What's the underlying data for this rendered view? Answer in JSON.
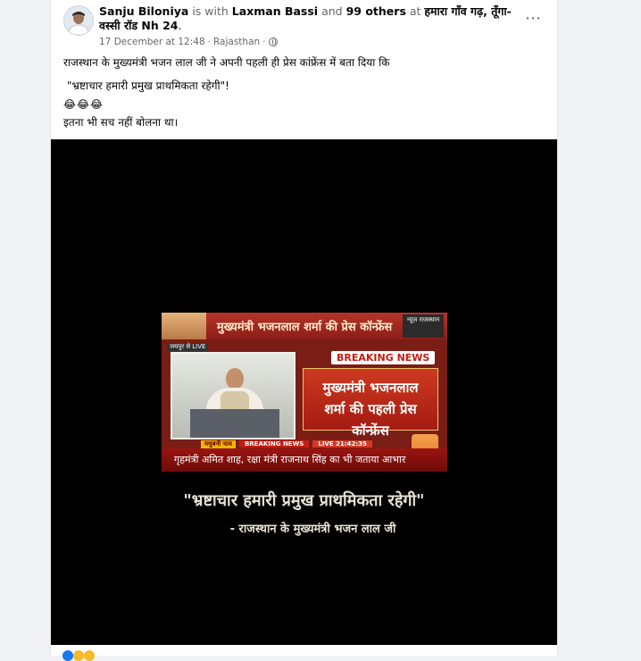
{
  "post": {
    "author": "Sanju Biloniya",
    "with_text": "is with",
    "tagged_person": "Laxman Bassi",
    "and_text": "and",
    "others": "99 others",
    "at_text": "at",
    "location": "हमारा गाँव गढ़, तूँगा-वस्सी रॉड Nh 24",
    "location_end": ".",
    "date": "17 December at 12:48",
    "separator": "·",
    "place": "Rajasthan",
    "separator2": "·",
    "more_icon": "⋯",
    "text_line1": "राजस्थान के मुख्यमंत्री भजन लाल जी ने अपनी पहली ही प्रेस कांफ्रेंस में बता दिया कि",
    "text_line2": "\"भ्रष्टाचार हमारी प्रमुख प्राथमिकता रहेगी\"!",
    "emojis": "😂😂😂",
    "text_line4": "इतना भी सच नहीं बोलना था।"
  },
  "video": {
    "banner_title": "मुख्यमंत्री भजनलाल शर्मा की प्रेस कॉन्फ्रेंस",
    "channel_logo": "न्यूज़ राजस्थान",
    "live_tag": "जयपुर से LIVE",
    "breaking_label": "BREAKING NEWS",
    "headline_line1": "मुख्यमंत्री भजनलाल",
    "headline_line2": "शर्मा की पहली प्रेस कॉन्फ्रेंस",
    "ticker_prefix": "मधुबनी चाय",
    "ticker_label": "BREAKING NEWS",
    "ticker_time": "LIVE 21:42:35",
    "lower_third": "गृहमंत्री अमित शाह, रक्षा मंत्री राजनाथ सिंह का भी जताया आभार",
    "quote": "\"भ्रष्टाचार हमारी प्रमुख प्राथमिकता रहेगी\"",
    "attribution": "- राजस्थान के मुख्यमंत्री भजन लाल जी"
  },
  "colors": {
    "link_blue": "#1877f2",
    "breaking_red": "#c41d12",
    "quote_text": "#e9e3d6"
  }
}
